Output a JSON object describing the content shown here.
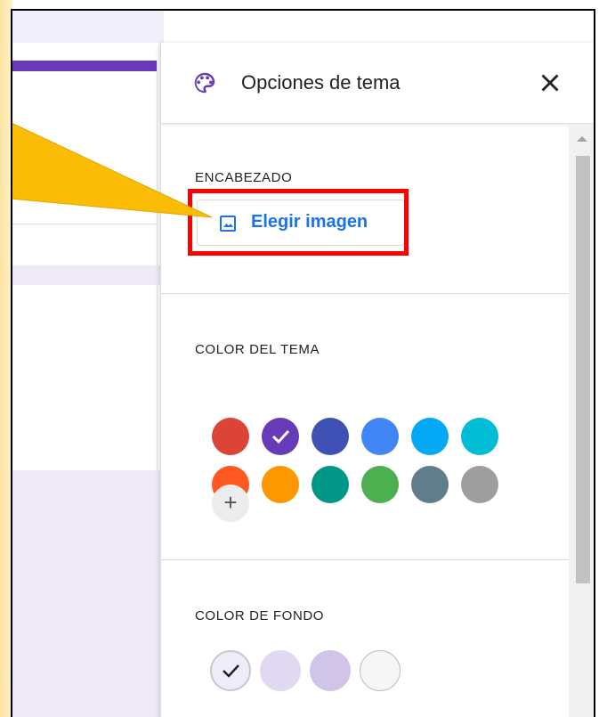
{
  "panel": {
    "title": "Opciones de tema",
    "close_icon": "close-icon",
    "palette_icon": "palette-icon"
  },
  "header_section": {
    "label": "ENCABEZADO",
    "choose_image_label": "Elegir imagen",
    "button_icon": "image-icon",
    "highlight_color": "#ff0000"
  },
  "theme_color_section": {
    "label": "COLOR DEL TEMA",
    "colors": [
      "#db4437",
      "#673ab7",
      "#3f51b5",
      "#4285f4",
      "#03a9f4",
      "#00bcd4",
      "#ff5722",
      "#ff9800",
      "#009688",
      "#4caf50",
      "#607d8b",
      "#9e9e9e"
    ],
    "selected_index": 1,
    "add_label": "+"
  },
  "background_color_section": {
    "label": "COLOR DE FONDO",
    "colors": [
      "#f0ebf8",
      "#e1d9f1",
      "#d1c4e9",
      "#f6f6f6"
    ],
    "selected_index": 0
  },
  "accent": {
    "arrow": "#fbbc05",
    "brand": "#673ab7",
    "link": "#1a73e8"
  }
}
